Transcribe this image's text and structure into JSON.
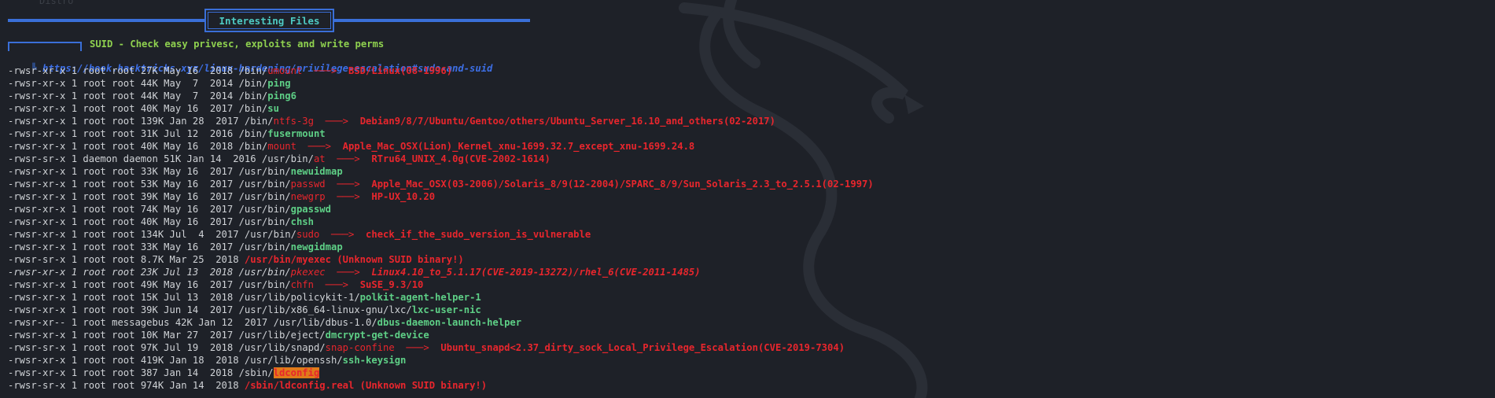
{
  "top_fragment": "Distro",
  "banner": {
    "title": "Interesting Files"
  },
  "section": {
    "title": "SUID - Check easy privesc, exploits and write perms",
    "link_mark": "╚",
    "link": "https://book.hacktricks.xyz/linux-hardening/privilege-escalation#sudo-and-suid"
  },
  "colors": {
    "background": "#1e2128",
    "blue": "#3a6fd8",
    "cyan": "#4ec9c2",
    "green": "#5ecf86",
    "lime": "#8fd14f",
    "red": "#e8262d",
    "orange": "#e07a1a",
    "text": "#cfd2d6"
  },
  "entries": [
    {
      "perms": "-rwsr-xr-x",
      "links": "1",
      "owner": "root",
      "group": "root",
      "size": "27K",
      "date": "May 16  2018",
      "dir": "/bin/",
      "name": "umount",
      "style": "red",
      "exploit": "BSD/Linux(08-1996)"
    },
    {
      "perms": "-rwsr-xr-x",
      "links": "1",
      "owner": "root",
      "group": "root",
      "size": "44K",
      "date": "May  7  2014",
      "dir": "/bin/",
      "name": "ping",
      "style": "green",
      "exploit": ""
    },
    {
      "perms": "-rwsr-xr-x",
      "links": "1",
      "owner": "root",
      "group": "root",
      "size": "44K",
      "date": "May  7  2014",
      "dir": "/bin/",
      "name": "ping6",
      "style": "green",
      "exploit": ""
    },
    {
      "perms": "-rwsr-xr-x",
      "links": "1",
      "owner": "root",
      "group": "root",
      "size": "40K",
      "date": "May 16  2017",
      "dir": "/bin/",
      "name": "su",
      "style": "green",
      "exploit": ""
    },
    {
      "perms": "-rwsr-xr-x",
      "links": "1",
      "owner": "root",
      "group": "root",
      "size": "139K",
      "date": "Jan 28  2017",
      "dir": "/bin/",
      "name": "ntfs-3g",
      "style": "red",
      "exploit": "Debian9/8/7/Ubuntu/Gentoo/others/Ubuntu_Server_16.10_and_others(02-2017)"
    },
    {
      "perms": "-rwsr-xr-x",
      "links": "1",
      "owner": "root",
      "group": "root",
      "size": "31K",
      "date": "Jul 12  2016",
      "dir": "/bin/",
      "name": "fusermount",
      "style": "green",
      "exploit": ""
    },
    {
      "perms": "-rwsr-xr-x",
      "links": "1",
      "owner": "root",
      "group": "root",
      "size": "40K",
      "date": "May 16  2018",
      "dir": "/bin/",
      "name": "mount",
      "style": "red",
      "exploit": "Apple_Mac_OSX(Lion)_Kernel_xnu-1699.32.7_except_xnu-1699.24.8"
    },
    {
      "perms": "-rwsr-sr-x",
      "links": "1",
      "owner": "daemon",
      "group": "daemon",
      "size": "51K",
      "date": "Jan 14  2016",
      "dir": "/usr/bin/",
      "name": "at",
      "style": "red",
      "exploit": "RTru64_UNIX_4.0g(CVE-2002-1614)"
    },
    {
      "perms": "-rwsr-xr-x",
      "links": "1",
      "owner": "root",
      "group": "root",
      "size": "33K",
      "date": "May 16  2017",
      "dir": "/usr/bin/",
      "name": "newuidmap",
      "style": "green",
      "exploit": ""
    },
    {
      "perms": "-rwsr-xr-x",
      "links": "1",
      "owner": "root",
      "group": "root",
      "size": "53K",
      "date": "May 16  2017",
      "dir": "/usr/bin/",
      "name": "passwd",
      "style": "red",
      "exploit": "Apple_Mac_OSX(03-2006)/Solaris_8/9(12-2004)/SPARC_8/9/Sun_Solaris_2.3_to_2.5.1(02-1997)"
    },
    {
      "perms": "-rwsr-xr-x",
      "links": "1",
      "owner": "root",
      "group": "root",
      "size": "39K",
      "date": "May 16  2017",
      "dir": "/usr/bin/",
      "name": "newgrp",
      "style": "red",
      "exploit": "HP-UX_10.20"
    },
    {
      "perms": "-rwsr-xr-x",
      "links": "1",
      "owner": "root",
      "group": "root",
      "size": "74K",
      "date": "May 16  2017",
      "dir": "/usr/bin/",
      "name": "gpasswd",
      "style": "green",
      "exploit": ""
    },
    {
      "perms": "-rwsr-xr-x",
      "links": "1",
      "owner": "root",
      "group": "root",
      "size": "40K",
      "date": "May 16  2017",
      "dir": "/usr/bin/",
      "name": "chsh",
      "style": "green",
      "exploit": ""
    },
    {
      "perms": "-rwsr-xr-x",
      "links": "1",
      "owner": "root",
      "group": "root",
      "size": "134K",
      "date": "Jul  4  2017",
      "dir": "/usr/bin/",
      "name": "sudo",
      "style": "red",
      "exploit": "check_if_the_sudo_version_is_vulnerable"
    },
    {
      "perms": "-rwsr-xr-x",
      "links": "1",
      "owner": "root",
      "group": "root",
      "size": "33K",
      "date": "May 16  2017",
      "dir": "/usr/bin/",
      "name": "newgidmap",
      "style": "green",
      "exploit": ""
    },
    {
      "perms": "-rwsr-sr-x",
      "links": "1",
      "owner": "root",
      "group": "root",
      "size": "8.7K",
      "date": "Mar 25  2018",
      "dir": "",
      "name": "/usr/bin/myexec (Unknown SUID binary!)",
      "style": "redbold",
      "exploit": ""
    },
    {
      "perms": "-rwsr-xr-x",
      "links": "1",
      "owner": "root",
      "group": "root",
      "size": "23K",
      "date": "Jul 13  2018",
      "dir": "/usr/bin/",
      "name": "pkexec",
      "style": "red",
      "exploit": "Linux4.10_to_5.1.17(CVE-2019-13272)/rhel_6(CVE-2011-1485)",
      "italic": true
    },
    {
      "perms": "-rwsr-xr-x",
      "links": "1",
      "owner": "root",
      "group": "root",
      "size": "49K",
      "date": "May 16  2017",
      "dir": "/usr/bin/",
      "name": "chfn",
      "style": "red",
      "exploit": "SuSE_9.3/10"
    },
    {
      "perms": "-rwsr-xr-x",
      "links": "1",
      "owner": "root",
      "group": "root",
      "size": "15K",
      "date": "Jul 13  2018",
      "dir": "/usr/lib/policykit-1/",
      "name": "polkit-agent-helper-1",
      "style": "green",
      "exploit": ""
    },
    {
      "perms": "-rwsr-xr-x",
      "links": "1",
      "owner": "root",
      "group": "root",
      "size": "39K",
      "date": "Jun 14  2017",
      "dir": "/usr/lib/x86_64-linux-gnu/lxc/",
      "name": "lxc-user-nic",
      "style": "green",
      "exploit": ""
    },
    {
      "perms": "-rwsr-xr--",
      "links": "1",
      "owner": "root",
      "group": "messagebus",
      "size": "42K",
      "date": "Jan 12  2017",
      "dir": "/usr/lib/dbus-1.0/",
      "name": "dbus-daemon-launch-helper",
      "style": "green",
      "exploit": ""
    },
    {
      "perms": "-rwsr-xr-x",
      "links": "1",
      "owner": "root",
      "group": "root",
      "size": "10K",
      "date": "Mar 27  2017",
      "dir": "/usr/lib/eject/",
      "name": "dmcrypt-get-device",
      "style": "green",
      "exploit": ""
    },
    {
      "perms": "-rwsr-sr-x",
      "links": "1",
      "owner": "root",
      "group": "root",
      "size": "97K",
      "date": "Jul 19  2018",
      "dir": "/usr/lib/snapd/",
      "name": "snap-confine",
      "style": "red",
      "exploit": "Ubuntu_snapd<2.37_dirty_sock_Local_Privilege_Escalation(CVE-2019-7304)"
    },
    {
      "perms": "-rwsr-xr-x",
      "links": "1",
      "owner": "root",
      "group": "root",
      "size": "419K",
      "date": "Jan 18  2018",
      "dir": "/usr/lib/openssh/",
      "name": "ssh-keysign",
      "style": "green",
      "exploit": ""
    },
    {
      "perms": "-rwsr-xr-x",
      "links": "1",
      "owner": "root",
      "group": "root",
      "size": "387",
      "date": "Jan 14  2018",
      "dir": "/sbin/",
      "name": "ldconfig",
      "style": "hl",
      "exploit": ""
    },
    {
      "perms": "-rwsr-sr-x",
      "links": "1",
      "owner": "root",
      "group": "root",
      "size": "974K",
      "date": "Jan 14  2018",
      "dir": "",
      "name": "/sbin/ldconfig.real (Unknown SUID binary!)",
      "style": "redbold",
      "exploit": ""
    }
  ]
}
